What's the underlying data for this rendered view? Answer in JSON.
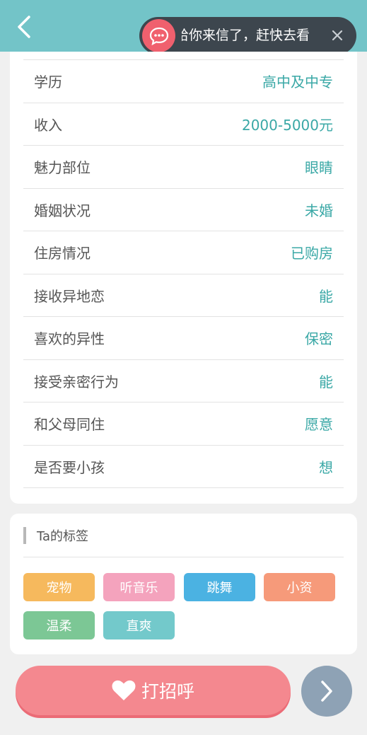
{
  "notification": {
    "text": "给你来信了，赶快去看"
  },
  "profile_rows": [
    {
      "label": "学历",
      "value": "高中及中专"
    },
    {
      "label": "收入",
      "value": "2000-5000元"
    },
    {
      "label": "魅力部位",
      "value": "眼睛"
    },
    {
      "label": "婚姻状况",
      "value": "未婚"
    },
    {
      "label": "住房情况",
      "value": "已购房"
    },
    {
      "label": "接收异地恋",
      "value": "能"
    },
    {
      "label": "喜欢的异性",
      "value": "保密"
    },
    {
      "label": "接受亲密行为",
      "value": "能"
    },
    {
      "label": "和父母同住",
      "value": "愿意"
    },
    {
      "label": "是否要小孩",
      "value": "想"
    }
  ],
  "tags": {
    "title": "Ta的标签",
    "items": [
      {
        "label": "宠物",
        "color": "#f6b95d"
      },
      {
        "label": "听音乐",
        "color": "#f4a3bd"
      },
      {
        "label": "跳舞",
        "color": "#4bb2e2"
      },
      {
        "label": "小资",
        "color": "#f69a7a"
      },
      {
        "label": "温柔",
        "color": "#7cc795"
      },
      {
        "label": "直爽",
        "color": "#73c9cb"
      }
    ]
  },
  "actions": {
    "greet_label": "打招呼"
  },
  "colors": {
    "header": "#73c4c8",
    "accent": "#3aa8a6",
    "greet": "#f4888f",
    "next": "#8ea2b5"
  }
}
